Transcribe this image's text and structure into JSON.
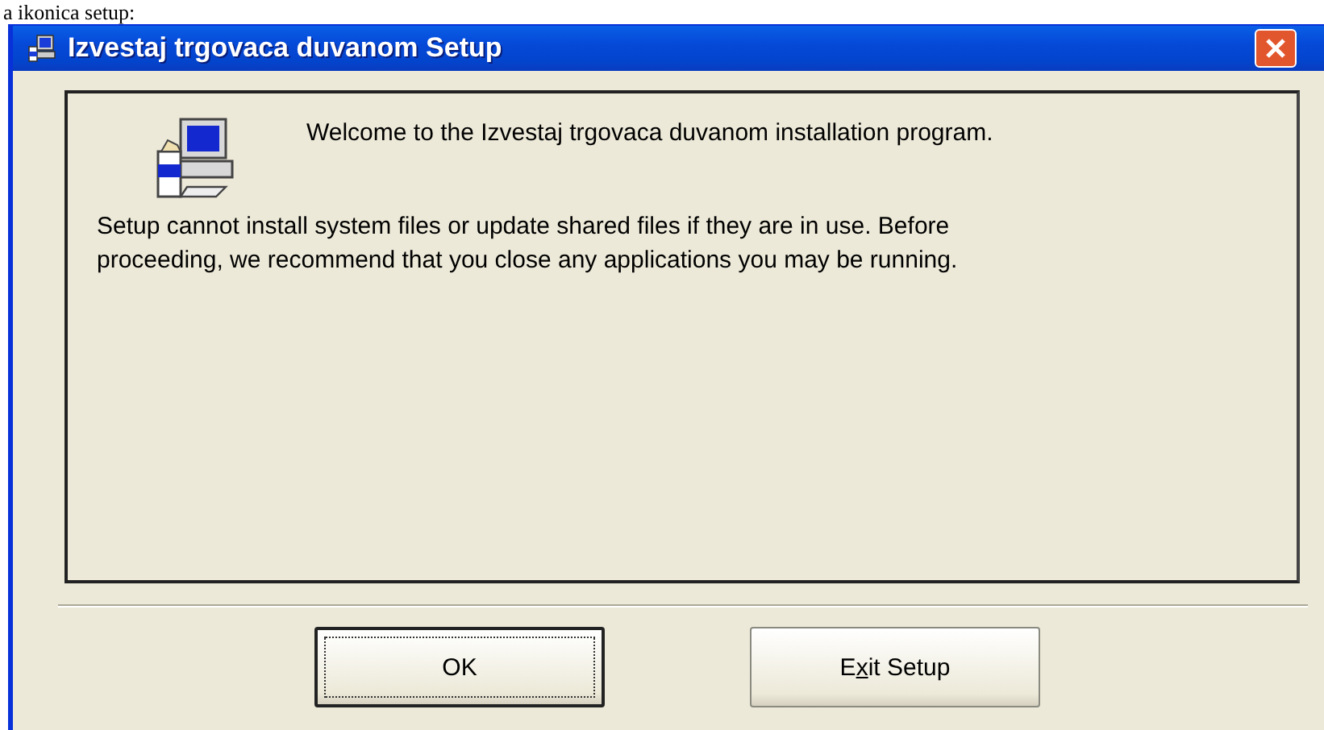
{
  "caption": "a ikonica setup:",
  "window": {
    "title": "Izvestaj trgovaca duvanom Setup"
  },
  "welcome": "Welcome to the Izvestaj trgovaca duvanom installation program.",
  "message": "Setup cannot install system files or update shared files if they are in use. Before proceeding, we recommend that you close any applications you may be running.",
  "buttons": [
    {
      "label_parts": [
        "OK"
      ],
      "focused": true
    },
    {
      "label_parts": [
        "E",
        "x",
        "it Setup"
      ],
      "focused": false
    }
  ]
}
